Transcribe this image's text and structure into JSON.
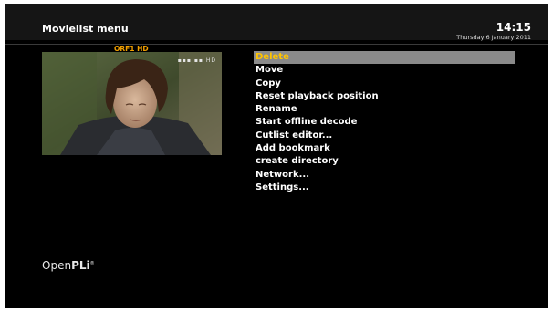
{
  "header": {
    "title": "Movielist menu",
    "time": "14:15",
    "date": "Thursday  6 January 2011"
  },
  "preview": {
    "channel": "ORF1 HD",
    "signal_indicator": "▪▪▪ ▪▪ HD"
  },
  "menu": {
    "selected_index": 0,
    "items": [
      {
        "label": "Delete"
      },
      {
        "label": "Move"
      },
      {
        "label": "Copy"
      },
      {
        "label": "Reset playback position"
      },
      {
        "label": "Rename"
      },
      {
        "label": "Start offline decode"
      },
      {
        "label": "Cutlist editor..."
      },
      {
        "label": "Add bookmark"
      },
      {
        "label": "create directory"
      },
      {
        "label": "Network..."
      },
      {
        "label": "Settings..."
      }
    ]
  },
  "branding": {
    "logo_part1": "Open",
    "logo_part2": "PLi",
    "logo_mark": "®"
  },
  "colors": {
    "accent": "#ffc400",
    "channel": "#f2a000",
    "selection_bg": "#8a8a8a",
    "background": "#000000"
  }
}
